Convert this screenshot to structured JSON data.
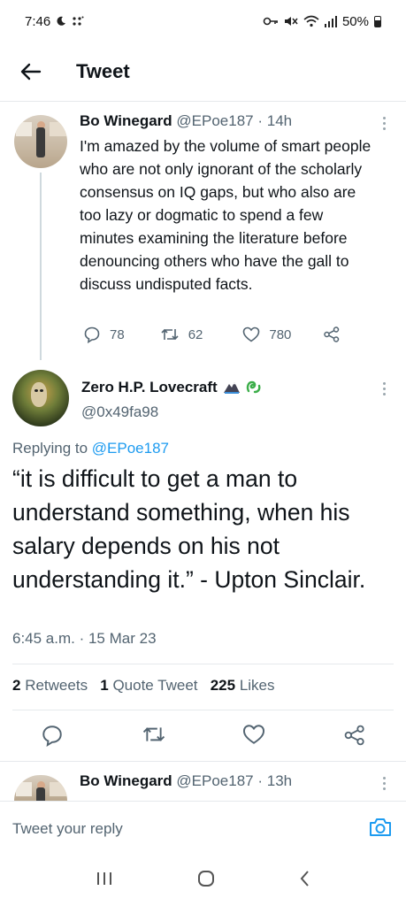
{
  "status_bar": {
    "time": "7:46",
    "battery": "50%"
  },
  "header": {
    "title": "Tweet"
  },
  "parent_tweet": {
    "name": "Bo Winegard",
    "handle": "@EPoe187",
    "age": "14h",
    "text": "I'm amazed by the volume of smart people who are not only ignorant of the scholarly consensus on IQ gaps, but who also are too lazy or dogmatic to spend a few minutes examining the literature before denouncing others who have the gall to discuss undisputed facts.",
    "replies": "78",
    "retweets": "62",
    "likes": "780"
  },
  "main_tweet": {
    "name": "Zero H.P. Lovecraft",
    "handle": "@0x49fa98",
    "replying_prefix": "Replying to",
    "replying_to": "@EPoe187",
    "text": "“it is difficult to get a man to understand something, when his salary depends on his not understanding it.” - Upton Sinclair.",
    "timestamp": "6:45 a.m. · 15 Mar 23",
    "retweets_count": "2",
    "retweets_label": "Retweets",
    "quotes_count": "1",
    "quotes_label": "Quote Tweet",
    "likes_count": "225",
    "likes_label": "Likes"
  },
  "next_tweet": {
    "name": "Bo Winegard",
    "handle": "@EPoe187",
    "age": "13h"
  },
  "reply_box": {
    "placeholder": "Tweet your reply"
  },
  "colors": {
    "accent": "#1d9bf0",
    "text_primary": "#0f1419",
    "text_secondary": "#536471",
    "divider": "#e6e9ec"
  }
}
